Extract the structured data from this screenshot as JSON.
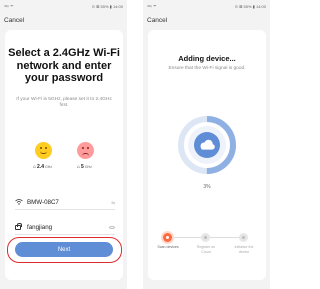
{
  "status_bar": {
    "left_icons": "⚌ᵢₗ ᯤ",
    "right_text": "⊙ ⊠ 55% ▮ 14:00"
  },
  "left_screen": {
    "cancel": "Cancel",
    "title": "Select a 2.4GHz Wi-Fi network and enter your password",
    "hint": "If your Wi-Fi is 5GHz, please set it to 2.4GHz first.",
    "bands": [
      {
        "label": "2.4",
        "unit": "GHz",
        "status": "supported",
        "face_icon": "happy-face-icon"
      },
      {
        "label": "5",
        "unit": "GHz",
        "status": "unsupported",
        "face_icon": "sad-face-icon"
      }
    ],
    "wifi_ssid": "BMW-08C7",
    "password": "fangjiang",
    "switch_glyph": "⇆",
    "next": "Next",
    "accent": "#5f8dd6",
    "highlight_color": "#dd2c2c"
  },
  "right_screen": {
    "cancel": "Cancel",
    "title": "Adding device...",
    "hint": "Ensure that the Wi-Fi signal is good.",
    "progress_percent": 3,
    "progress_text": "3%",
    "ring_color": "#8fb0e3",
    "steps": [
      {
        "label": "Scan devices",
        "state": "active"
      },
      {
        "label": "Register on Cloud",
        "state": "pending"
      },
      {
        "label": "Initialize the device",
        "state": "pending"
      }
    ],
    "active_color": "#ff6a3d"
  }
}
